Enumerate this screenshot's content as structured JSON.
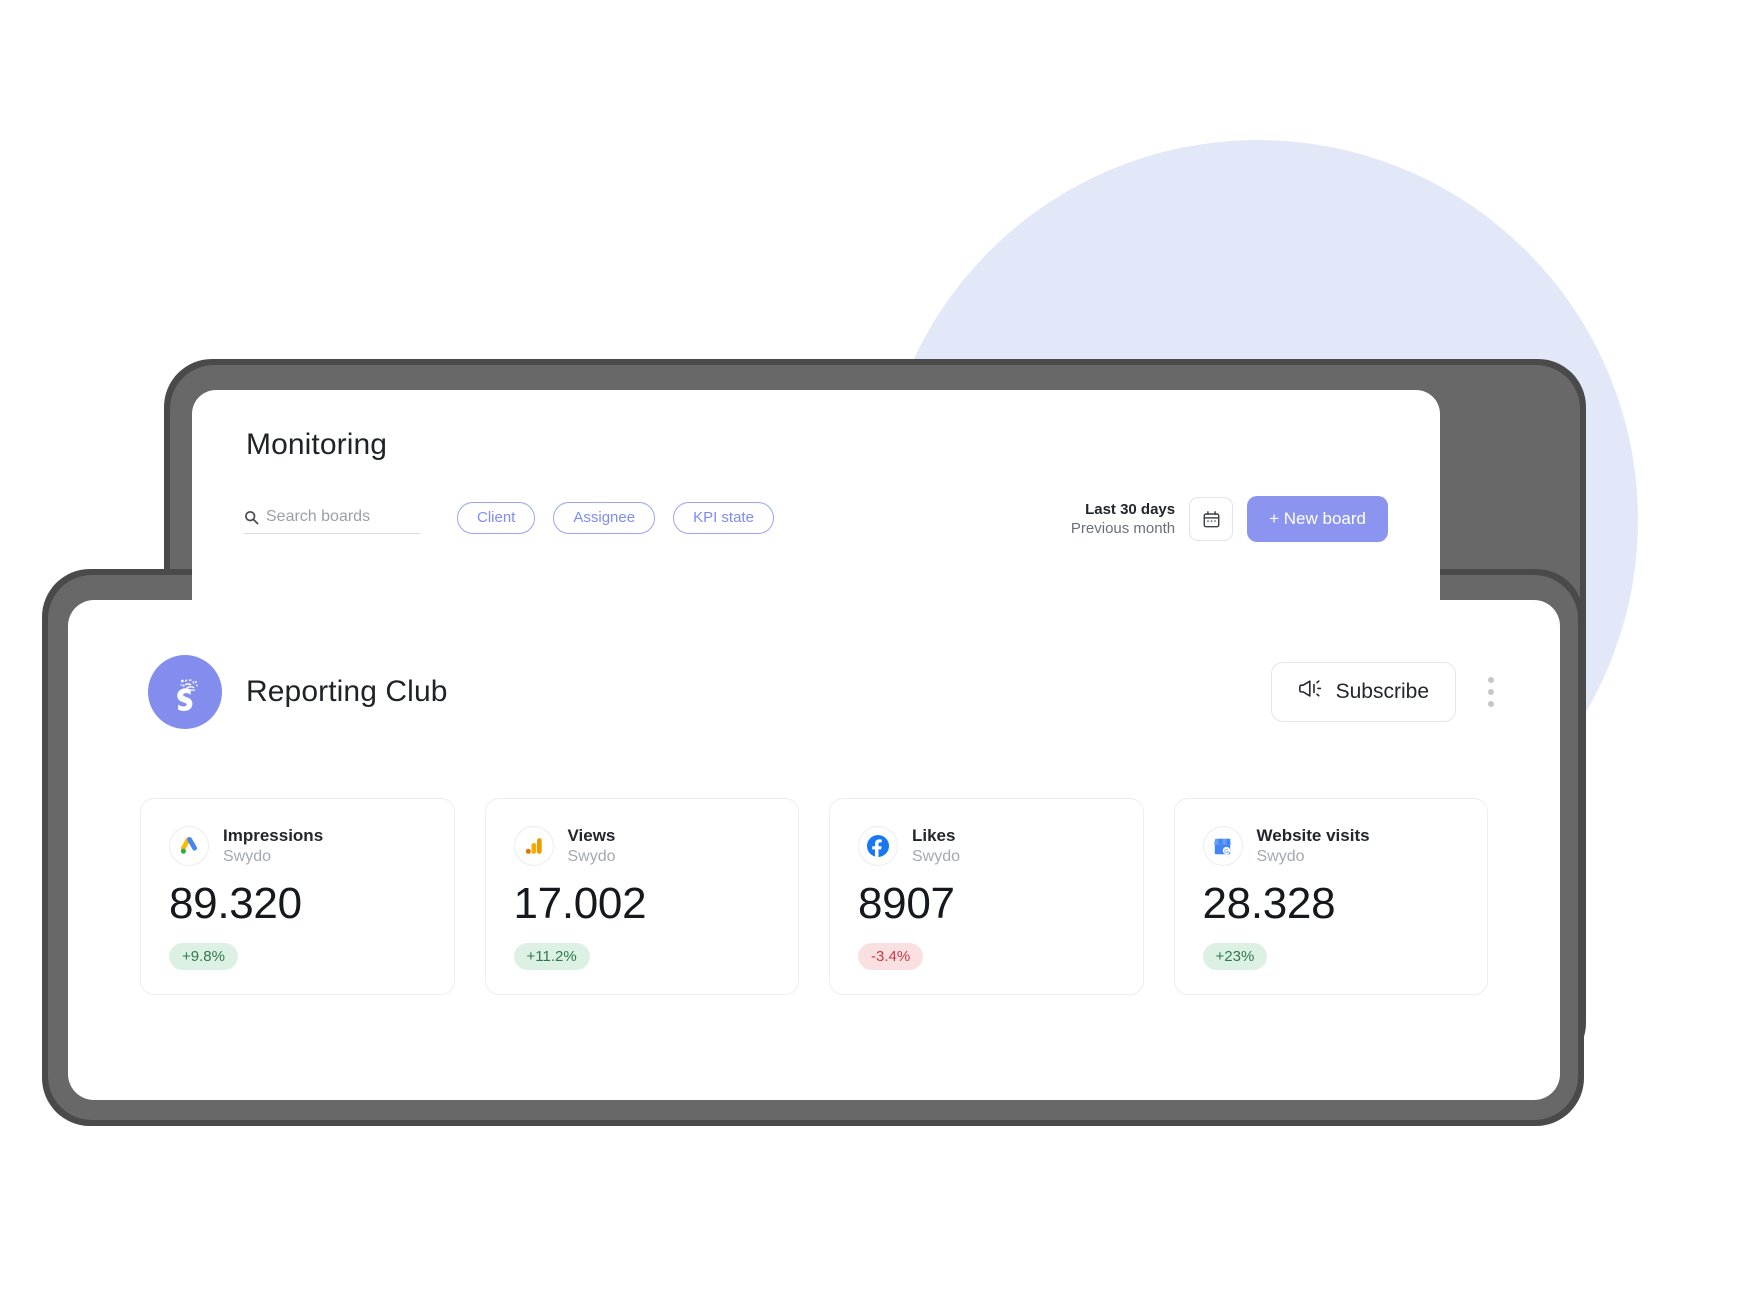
{
  "colors": {
    "accent": "#8b95ef",
    "chip_border": "#9aa4f2",
    "bg_circle": "#e3e8f9",
    "bezel": "#686868",
    "delta_up_bg": "#dcf0e3",
    "delta_up_text": "#2d7a4c",
    "delta_down_bg": "#fbe0e2",
    "delta_down_text": "#c23b46"
  },
  "monitoring": {
    "title": "Monitoring",
    "search": {
      "placeholder": "Search boards",
      "value": "",
      "icon": "search-icon"
    },
    "filters": [
      {
        "label": "Client"
      },
      {
        "label": "Assignee"
      },
      {
        "label": "KPI state"
      }
    ],
    "date_range": {
      "primary": "Last 30 days",
      "secondary": "Previous month",
      "icon": "calendar-icon"
    },
    "new_board_label": "+  New board"
  },
  "board": {
    "logo_icon": "swydo-logo-icon",
    "name": "Reporting Club",
    "subscribe_label": "Subscribe",
    "subscribe_icon": "megaphone-icon",
    "menu_icon": "kebab-menu-icon",
    "kpis": [
      {
        "label": "Impressions",
        "source": "Swydo",
        "value": "89.320",
        "delta": "+9.8%",
        "direction": "up",
        "icon": "google-ads-icon"
      },
      {
        "label": "Views",
        "source": "Swydo",
        "value": "17.002",
        "delta": "+11.2%",
        "direction": "up",
        "icon": "google-analytics-icon"
      },
      {
        "label": "Likes",
        "source": "Swydo",
        "value": "8907",
        "delta": "-3.4%",
        "direction": "down",
        "icon": "facebook-icon"
      },
      {
        "label": "Website visits",
        "source": "Swydo",
        "value": "28.328",
        "delta": "+23%",
        "direction": "up",
        "icon": "google-business-profile-icon"
      }
    ]
  }
}
